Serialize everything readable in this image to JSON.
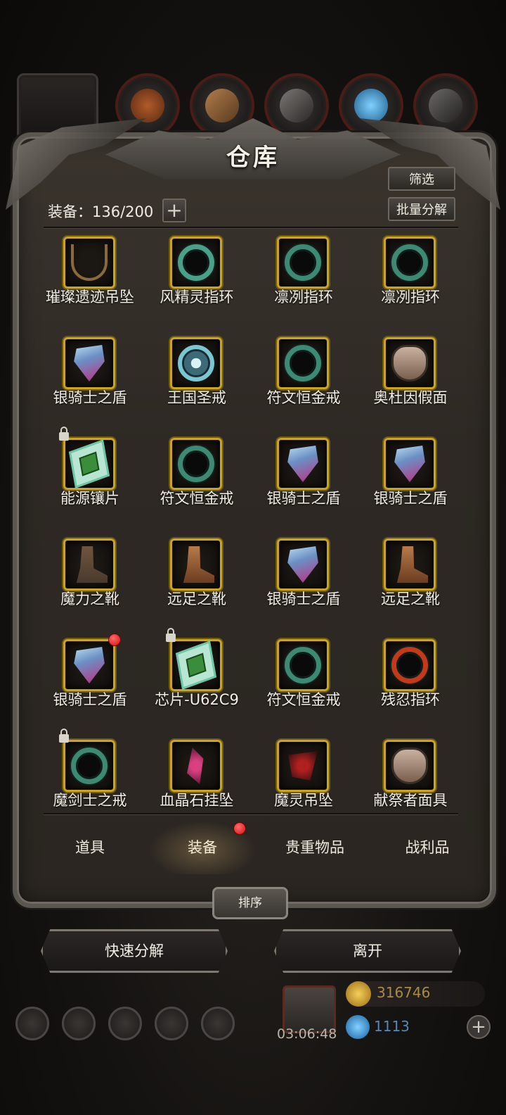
{
  "title": "仓库",
  "filter_button": "筛选",
  "batch_disassemble_button": "批量分解",
  "capacity_label": "装备：136/200",
  "capacity_plus": "+",
  "items": [
    {
      "name": "璀璨遗迹吊坠",
      "icon": "necklace-icon",
      "locked": false,
      "new": false
    },
    {
      "name": "风精灵指环",
      "icon": "green-ring-icon",
      "locked": false,
      "new": false
    },
    {
      "name": "凛冽指环",
      "icon": "ring-icon",
      "locked": false,
      "new": false
    },
    {
      "name": "凛冽指环",
      "icon": "ring-icon",
      "locked": false,
      "new": false
    },
    {
      "name": "银骑士之盾",
      "icon": "shield-icon",
      "locked": false,
      "new": false
    },
    {
      "name": "王国圣戒",
      "icon": "holy-ring-icon",
      "locked": false,
      "new": false
    },
    {
      "name": "符文恒金戒",
      "icon": "ring-icon",
      "locked": false,
      "new": false
    },
    {
      "name": "奥杜因假面",
      "icon": "mask-icon",
      "locked": false,
      "new": false
    },
    {
      "name": "能源镶片",
      "icon": "chip-icon",
      "locked": true,
      "new": false
    },
    {
      "name": "符文恒金戒",
      "icon": "ring-icon",
      "locked": false,
      "new": false
    },
    {
      "name": "银骑士之盾",
      "icon": "shield-icon",
      "locked": false,
      "new": false
    },
    {
      "name": "银骑士之盾",
      "icon": "shield-icon",
      "locked": false,
      "new": false
    },
    {
      "name": "魔力之靴",
      "icon": "boots-icon",
      "locked": false,
      "new": false
    },
    {
      "name": "远足之靴",
      "icon": "boots-icon",
      "locked": false,
      "new": false
    },
    {
      "name": "银骑士之盾",
      "icon": "shield-icon",
      "locked": false,
      "new": false
    },
    {
      "name": "远足之靴",
      "icon": "boots-icon",
      "locked": false,
      "new": false
    },
    {
      "name": "银骑士之盾",
      "icon": "shield-icon",
      "locked": false,
      "new": true
    },
    {
      "name": "芯片-U62C9",
      "icon": "chip-icon",
      "locked": true,
      "new": false
    },
    {
      "name": "符文恒金戒",
      "icon": "ring-icon",
      "locked": false,
      "new": false
    },
    {
      "name": "残忍指环",
      "icon": "red-ring-icon",
      "locked": false,
      "new": false
    },
    {
      "name": "魔剑士之戒",
      "icon": "ring-icon",
      "locked": true,
      "new": false
    },
    {
      "name": "血晶石挂坠",
      "icon": "pendant-icon",
      "locked": false,
      "new": false
    },
    {
      "name": "魔灵吊坠",
      "icon": "dark-pendant-icon",
      "locked": false,
      "new": false
    },
    {
      "name": "献祭者面具",
      "icon": "mask-icon",
      "locked": false,
      "new": false
    }
  ],
  "tabs": [
    {
      "label": "道具",
      "active": false,
      "new": false
    },
    {
      "label": "装备",
      "active": true,
      "new": true
    },
    {
      "label": "贵重物品",
      "active": false,
      "new": false
    },
    {
      "label": "战利品",
      "active": false,
      "new": false
    }
  ],
  "sort_button": "排序",
  "quick_disassemble_button": "快速分解",
  "leave_button": "离开",
  "timer": "03:06:48",
  "gold": "316746",
  "gems": "1113"
}
